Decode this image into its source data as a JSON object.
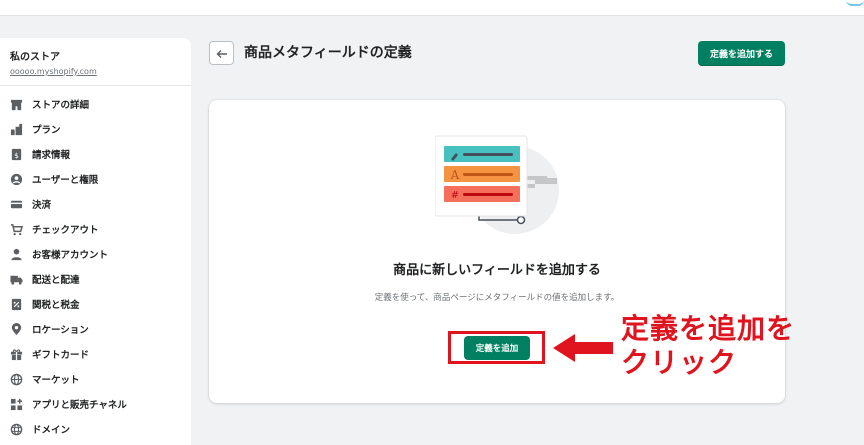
{
  "store": {
    "name": "私のストア",
    "url": "ooooo.myshopify.com"
  },
  "sidebar": {
    "items": [
      {
        "label": "ストアの詳細",
        "icon": "store-icon"
      },
      {
        "label": "プラン",
        "icon": "plan-icon"
      },
      {
        "label": "請求情報",
        "icon": "billing-icon"
      },
      {
        "label": "ユーザーと権限",
        "icon": "user-icon"
      },
      {
        "label": "決済",
        "icon": "credit-card-icon"
      },
      {
        "label": "チェックアウト",
        "icon": "cart-icon"
      },
      {
        "label": "お客様アカウント",
        "icon": "person-icon"
      },
      {
        "label": "配送と配達",
        "icon": "truck-icon"
      },
      {
        "label": "関税と税金",
        "icon": "tax-icon"
      },
      {
        "label": "ロケーション",
        "icon": "location-pin-icon"
      },
      {
        "label": "ギフトカード",
        "icon": "gift-icon"
      },
      {
        "label": "マーケット",
        "icon": "globe-icon"
      },
      {
        "label": "アプリと販売チャネル",
        "icon": "apps-icon"
      },
      {
        "label": "ドメイン",
        "icon": "domain-globe-icon"
      }
    ]
  },
  "header": {
    "title": "商品メタフィールドの定義",
    "primary_action": "定義を追加する"
  },
  "empty_state": {
    "heading": "商品に新しいフィールドを追加する",
    "description": "定義を使って、商品ページにメタフィールドの値を追加します。",
    "action": "定義を追加"
  },
  "annotation": {
    "line1": "定義を追加を",
    "line2": "クリック"
  },
  "colors": {
    "primary": "#008060",
    "annotation": "#e0141e",
    "illus_teal": "#47c1bf",
    "illus_orange": "#f49342",
    "illus_red": "#f66f5d"
  }
}
